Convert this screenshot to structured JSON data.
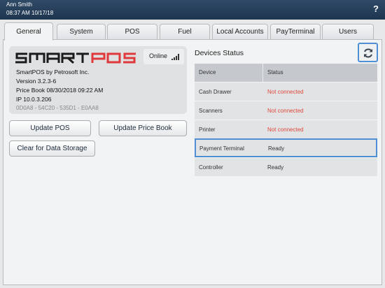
{
  "header": {
    "user": "Ann Smith",
    "datetime": "08:37 AM 10/17/18",
    "help_label": "?"
  },
  "tabs": [
    {
      "label": "General",
      "active": true
    },
    {
      "label": "System"
    },
    {
      "label": "POS"
    },
    {
      "label": "Fuel"
    },
    {
      "label": "Local Accounts"
    },
    {
      "label": "PayTerminal"
    },
    {
      "label": "Users"
    }
  ],
  "info": {
    "logo_text": "SMARTPOS",
    "online_label": "Online",
    "product": "SmartPOS by Petrosoft Inc.",
    "version": "Version 3.2.3-6",
    "price_book": "Price Book 08/30/2018 09:22 AM",
    "ip": "IP 10.0.3.206",
    "mac": "0D0A8 - 54C20 - 535D1 - E0AA8"
  },
  "buttons": {
    "update_pos": "Update POS",
    "update_price_book": "Update Price Book",
    "clear_data": "Clear for Data Storage"
  },
  "devices": {
    "title": "Devices Status",
    "columns": [
      "Device",
      "Status"
    ],
    "rows": [
      {
        "device": "Cash Drawer",
        "status": "Not connected"
      },
      {
        "device": "Scanners",
        "status": "Not connected"
      },
      {
        "device": "Printer",
        "status": "Not connected"
      },
      {
        "device": "Payment Terminal",
        "status": "Ready"
      },
      {
        "device": "Controller",
        "status": "Ready"
      }
    ]
  },
  "colors": {
    "accent": "#4f8fd4",
    "error": "#e0483a",
    "logo_red": "#e0393b",
    "header_bg": "#24394f"
  }
}
